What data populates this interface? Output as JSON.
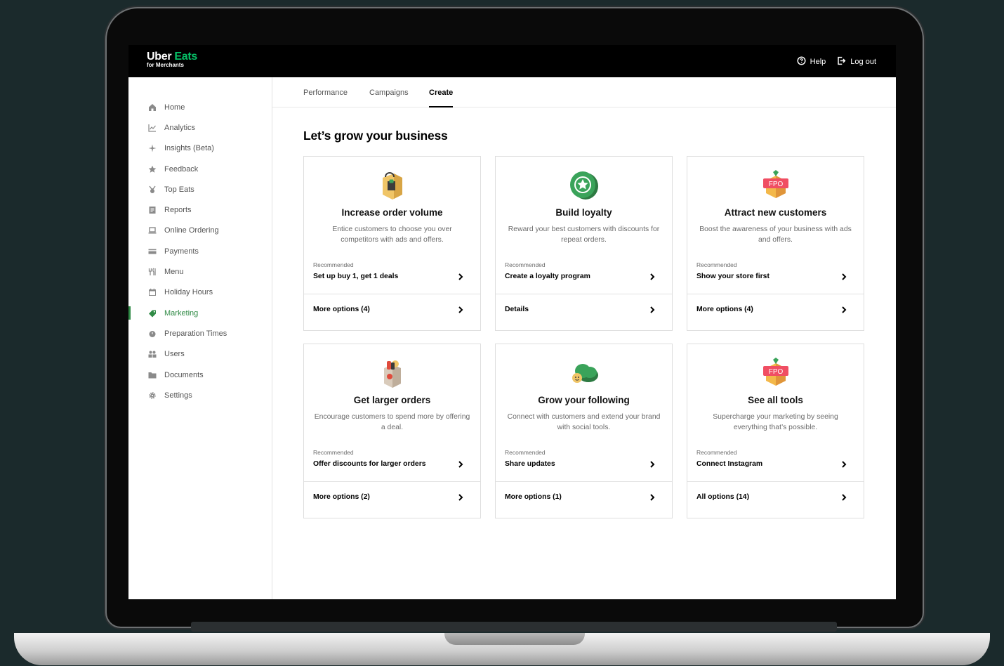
{
  "brand": {
    "name_part1": "Uber",
    "name_part2": "Eats",
    "subtitle": "for Merchants",
    "accent": "#06c167"
  },
  "header": {
    "help": "Help",
    "logout": "Log out"
  },
  "sidebar": {
    "items": [
      {
        "label": "Home",
        "icon": "home-icon"
      },
      {
        "label": "Analytics",
        "icon": "analytics-icon"
      },
      {
        "label": "Insights (Beta)",
        "icon": "sparkle-icon"
      },
      {
        "label": "Feedback",
        "icon": "star-icon"
      },
      {
        "label": "Top Eats",
        "icon": "medal-icon"
      },
      {
        "label": "Reports",
        "icon": "report-icon"
      },
      {
        "label": "Online Ordering",
        "icon": "laptop-icon"
      },
      {
        "label": "Payments",
        "icon": "card-icon"
      },
      {
        "label": "Menu",
        "icon": "utensils-icon"
      },
      {
        "label": "Holiday Hours",
        "icon": "calendar-icon"
      },
      {
        "label": "Marketing",
        "icon": "tag-icon",
        "active": true
      },
      {
        "label": "Preparation Times",
        "icon": "timer-icon"
      },
      {
        "label": "Users",
        "icon": "users-icon"
      },
      {
        "label": "Documents",
        "icon": "folder-icon"
      },
      {
        "label": "Settings",
        "icon": "gear-icon"
      }
    ],
    "active_color": "#2f8a45"
  },
  "tabs": [
    {
      "label": "Performance"
    },
    {
      "label": "Campaigns"
    },
    {
      "label": "Create",
      "active": true
    }
  ],
  "page_title": "Let’s grow your business",
  "recommended_label": "Recommended",
  "cards": [
    {
      "title": "Increase order volume",
      "desc": "Entice customers to choose you over competitors with ads and offers.",
      "recommended": "Set up buy 1, get 1 deals",
      "more": "More options (4)",
      "illustration": "shopping-bag-icon"
    },
    {
      "title": "Build loyalty",
      "desc": "Reward your best customers with discounts for repeat orders.",
      "recommended": "Create a loyalty program",
      "more": "Details",
      "illustration": "loyalty-badge-icon"
    },
    {
      "title": "Attract new customers",
      "desc": "Boost the awareness of your business with ads and offers.",
      "recommended": "Show your store first",
      "more": "More options (4)",
      "illustration": "fpo-placeholder-icon",
      "placeholder_text": "FPO"
    },
    {
      "title": "Get larger orders",
      "desc": "Encourage customers to spend more by offering a deal.",
      "recommended": "Offer discounts for larger orders",
      "more": "More options (2)",
      "illustration": "grocery-bag-icon"
    },
    {
      "title": "Grow your following",
      "desc": "Connect with customers and extend your brand with social tools.",
      "recommended": "Share updates",
      "more": "More options (1)",
      "illustration": "social-cloud-icon"
    },
    {
      "title": "See all tools",
      "desc": "Supercharge your marketing by seeing everything that’s possible.",
      "recommended": "Connect Instagram",
      "more": "All options (14)",
      "illustration": "fpo-placeholder-icon",
      "placeholder_text": "FPO"
    }
  ]
}
